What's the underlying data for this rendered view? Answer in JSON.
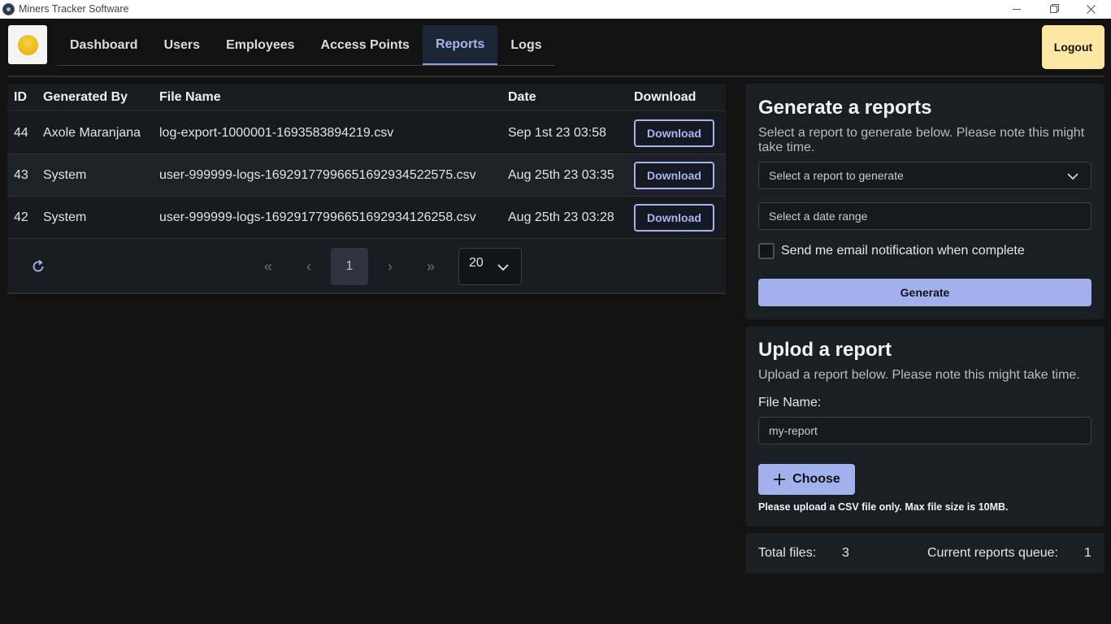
{
  "window": {
    "title": "Miners Tracker Software"
  },
  "nav": {
    "items": [
      {
        "label": "Dashboard"
      },
      {
        "label": "Users"
      },
      {
        "label": "Employees"
      },
      {
        "label": "Access Points"
      },
      {
        "label": "Reports"
      },
      {
        "label": "Logs"
      }
    ],
    "active": "Reports",
    "logout_label": "Logout"
  },
  "table": {
    "headers": {
      "id": "ID",
      "generated_by": "Generated By",
      "file_name": "File Name",
      "date": "Date",
      "download": "Download"
    },
    "rows": [
      {
        "id": "44",
        "generated_by": "Axole Maranjana",
        "file_name": "log-export-1000001-1693583894219.csv",
        "date": "Sep 1st 23 03:58",
        "action": "Download"
      },
      {
        "id": "43",
        "generated_by": "System",
        "file_name": "user-999999-logs-16929177996651692934522575.csv",
        "date": "Aug 25th 23 03:35",
        "action": "Download"
      },
      {
        "id": "42",
        "generated_by": "System",
        "file_name": "user-999999-logs-16929177996651692934126258.csv",
        "date": "Aug 25th 23 03:28",
        "action": "Download"
      }
    ],
    "paginator": {
      "first": "«",
      "prev": "‹",
      "current_page": "1",
      "next": "›",
      "last": "»",
      "rows_per_page": "20"
    }
  },
  "generate": {
    "title": "Generate a reports",
    "description": "Select a report to generate below. Please note this might take time.",
    "report_select_placeholder": "Select a report to generate",
    "date_range_placeholder": "Select a date range",
    "email_checkbox_label": "Send me email notification when complete",
    "email_checked": false,
    "button_label": "Generate"
  },
  "upload": {
    "title": "Uplod a report",
    "description": "Upload a report below. Please note this might take time.",
    "file_name_label": "File Name:",
    "file_name_value": "my-report",
    "choose_label": "Choose",
    "note": "Please upload a CSV file only. Max file size is 10MB."
  },
  "stats": {
    "total_files_label": "Total files:",
    "total_files_value": "3",
    "queue_label": "Current reports queue:",
    "queue_value": "1"
  },
  "colors": {
    "accent": "#a3b0ee",
    "logout_bg": "#fde7a3",
    "background": "#121212",
    "panel": "#1a1f24"
  },
  "icons": {
    "refresh": "refresh-icon",
    "chevron": "chevron-down-icon",
    "plus": "plus-icon",
    "logo": "sun-logo-icon"
  }
}
